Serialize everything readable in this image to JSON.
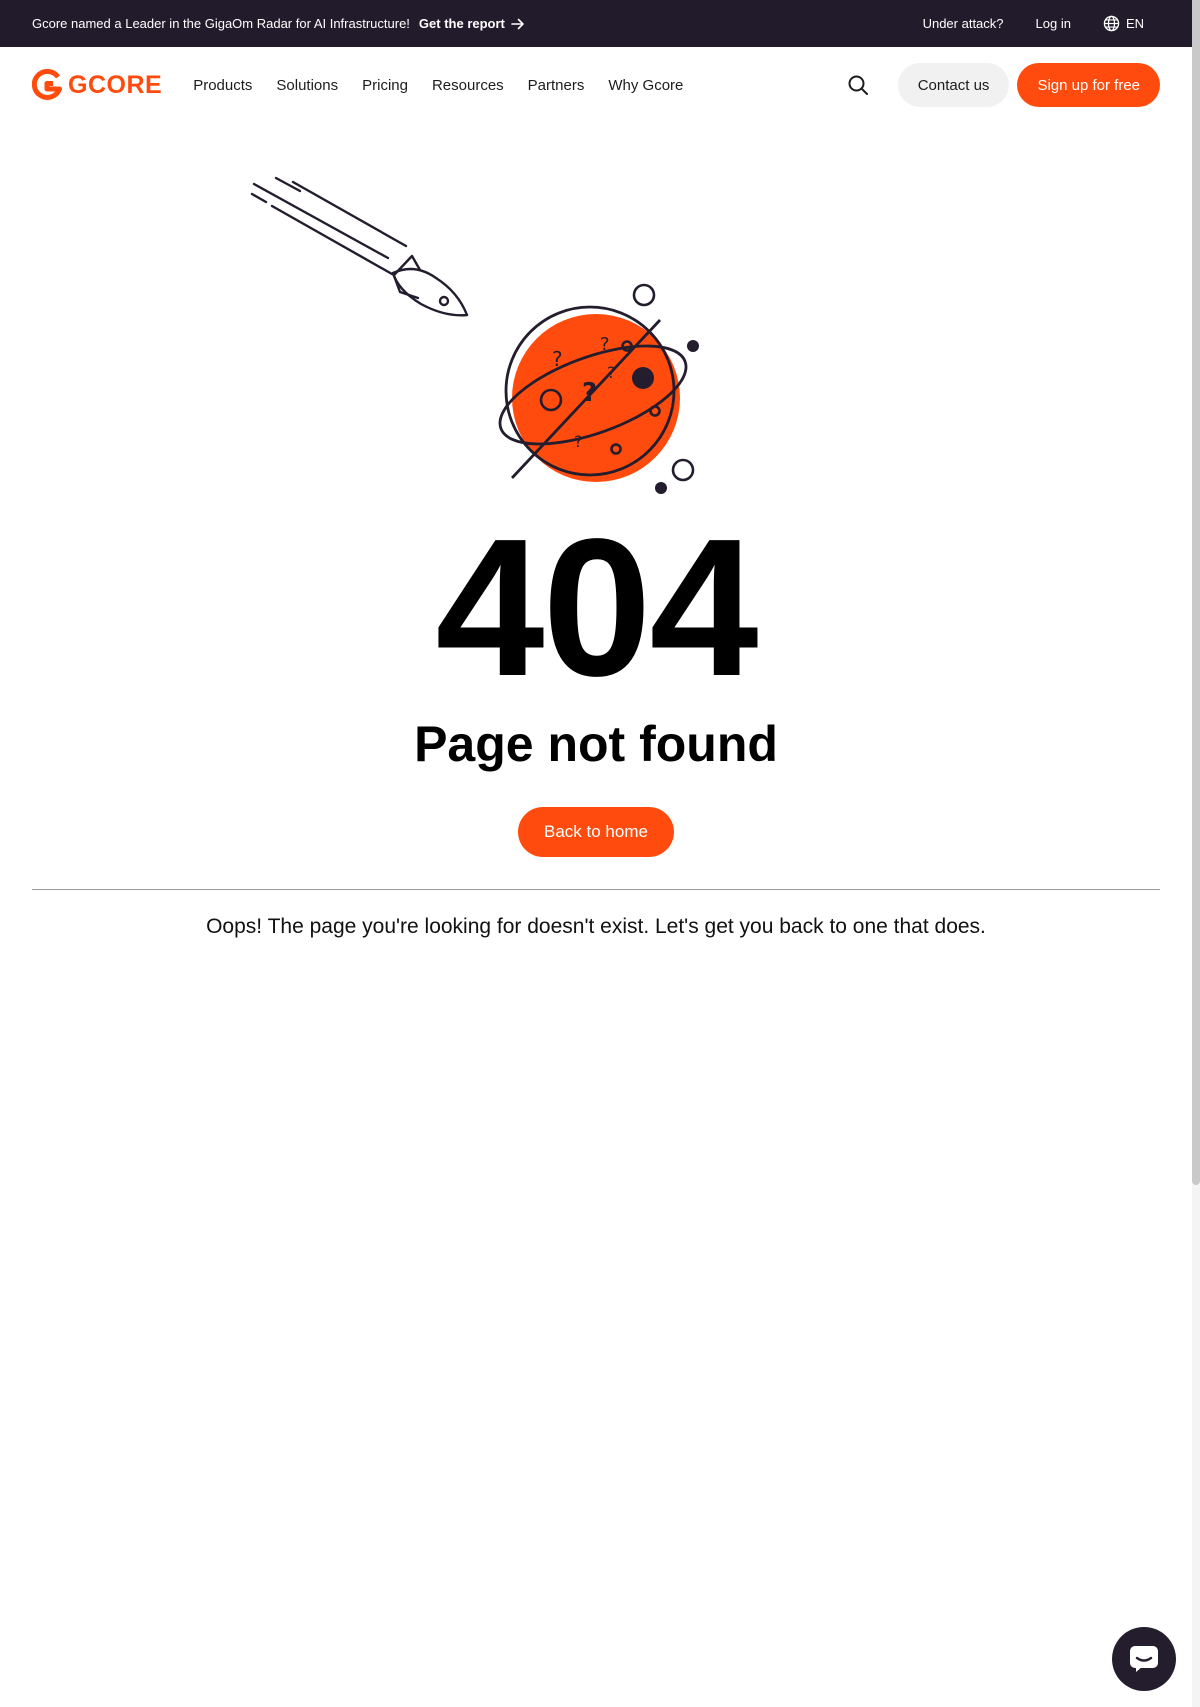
{
  "topbar": {
    "announcement": "Gcore named a Leader in the GigaOm Radar for AI Infrastructure!",
    "report_link": "Get the report",
    "under_attack": "Under attack?",
    "login": "Log in",
    "language": "EN"
  },
  "navbar": {
    "logo_text": "GCORE",
    "items": [
      "Products",
      "Solutions",
      "Pricing",
      "Resources",
      "Partners",
      "Why Gcore"
    ],
    "contact": "Contact us",
    "signup": "Sign up for free"
  },
  "main": {
    "code": "404",
    "title": "Page not found",
    "back_button": "Back to home",
    "message": "Oops! The page you're looking for doesn't exist. Let's get you back to one that does."
  },
  "colors": {
    "brand_orange": "#ff4c0e",
    "topbar_bg": "#211b2b",
    "chat_bg": "#241d2e"
  },
  "icons": {
    "report_arrow": "arrow-right-icon",
    "language": "globe-icon",
    "search": "search-icon",
    "chat": "chat-icon",
    "logo": "gcore-logo-icon"
  }
}
